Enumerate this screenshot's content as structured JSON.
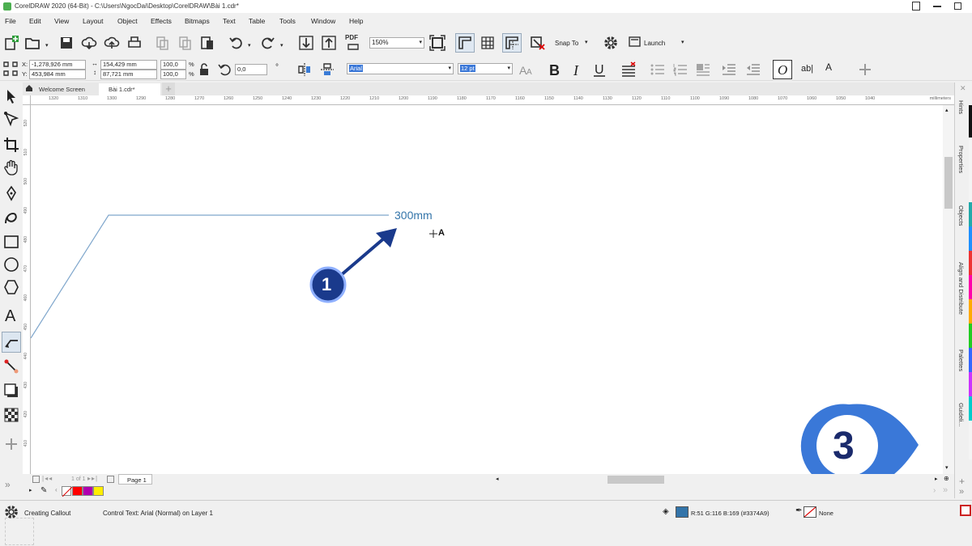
{
  "window": {
    "title": "CorelDRAW 2020 (64-Bit) - C:\\Users\\NgocDai\\Desktop\\CorelDRAW\\Bài 1.cdr*"
  },
  "menu": [
    "File",
    "Edit",
    "View",
    "Layout",
    "Object",
    "Effects",
    "Bitmaps",
    "Text",
    "Table",
    "Tools",
    "Window",
    "Help"
  ],
  "toolbar": {
    "zoom_value": "150%",
    "snap_label": "Snap To",
    "launch_label": "Launch",
    "pdf_label": "PDF"
  },
  "property_bar": {
    "x_label": "X:",
    "x_value": "-1,278,926 mm",
    "y_label": "Y:",
    "y_value": "453,984 mm",
    "width_value": "154,429 mm",
    "height_value": "87,721 mm",
    "scale_w": "100,0",
    "scale_h": "100,0",
    "percent": "%",
    "rotation": "0,0",
    "degree": "°",
    "font_name": "Arial",
    "font_size": "12 pt",
    "text_style_sample": "ab|",
    "superscript_sample": "A"
  },
  "doc_tabs": [
    "Welcome Screen",
    "Bài 1.cdr*"
  ],
  "ruler": {
    "h_ticks": [
      "1320",
      "1310",
      "1300",
      "1290",
      "1280",
      "1270",
      "1260",
      "1250",
      "1240",
      "1230",
      "1220",
      "1210",
      "1200",
      "1190",
      "1180",
      "1170",
      "1160",
      "1150",
      "1140",
      "1130",
      "1120",
      "1110",
      "1100",
      "1090",
      "1080",
      "1070",
      "1060",
      "1050",
      "1040"
    ],
    "h_unit": "millimeters",
    "v_ticks": [
      "520",
      "510",
      "500",
      "490",
      "480",
      "470",
      "460",
      "450",
      "440",
      "430",
      "420",
      "410"
    ]
  },
  "canvas": {
    "callout_text": "300mm",
    "callout_color": "#3374a9",
    "line_color": "#7fa6cc",
    "cursor_letter": "A",
    "badge_1": "1",
    "badge_3": "3"
  },
  "page_nav": {
    "page_count": "1 of 1",
    "page_tab": "Page 1"
  },
  "palette": [
    "none",
    "#ff0000",
    "#b000b0",
    "#ffee00"
  ],
  "right_dock": [
    "Hints",
    "Properties",
    "Objects",
    "Align and Distribute",
    "Palettes",
    "Guideli..."
  ],
  "status": {
    "tool": "Creating Callout",
    "info": "Control Text: Arial (Normal) on Layer 1",
    "fill_color": "#3374a9",
    "fill_text": "R:51 G:116 B:169 (#3374A9)",
    "outline_text": "None"
  }
}
